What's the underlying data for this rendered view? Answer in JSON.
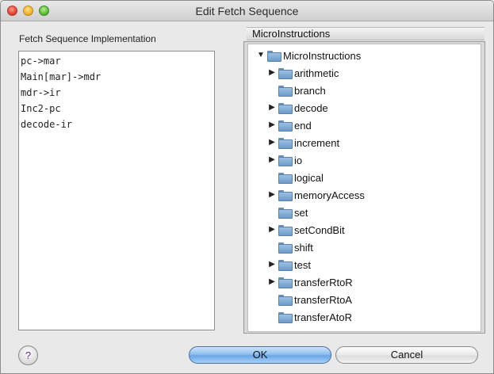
{
  "window": {
    "title": "Edit Fetch Sequence"
  },
  "left_panel": {
    "label": "Fetch Sequence Implementation",
    "items": [
      "pc->mar",
      "Main[mar]->mdr",
      "mdr->ir",
      "Inc2-pc",
      "decode-ir"
    ]
  },
  "right_panel": {
    "header": "MicroInstructions",
    "root": {
      "label": "MicroInstructions",
      "expanded": true,
      "icon": "folder-icon"
    },
    "children": [
      {
        "label": "arithmetic",
        "has_children": true
      },
      {
        "label": "branch",
        "has_children": false
      },
      {
        "label": "decode",
        "has_children": true
      },
      {
        "label": "end",
        "has_children": true
      },
      {
        "label": "increment",
        "has_children": true
      },
      {
        "label": "io",
        "has_children": true
      },
      {
        "label": "logical",
        "has_children": false
      },
      {
        "label": "memoryAccess",
        "has_children": true
      },
      {
        "label": "set",
        "has_children": false
      },
      {
        "label": "setCondBit",
        "has_children": true
      },
      {
        "label": "shift",
        "has_children": false
      },
      {
        "label": "test",
        "has_children": true
      },
      {
        "label": "transferRtoR",
        "has_children": true
      },
      {
        "label": "transferRtoA",
        "has_children": false
      },
      {
        "label": "transferAtoR",
        "has_children": false
      }
    ]
  },
  "buttons": {
    "help": "?",
    "ok": "OK",
    "cancel": "Cancel"
  },
  "colors": {
    "ok_button": "#8fbff0",
    "folder": "#7fa8d4"
  }
}
